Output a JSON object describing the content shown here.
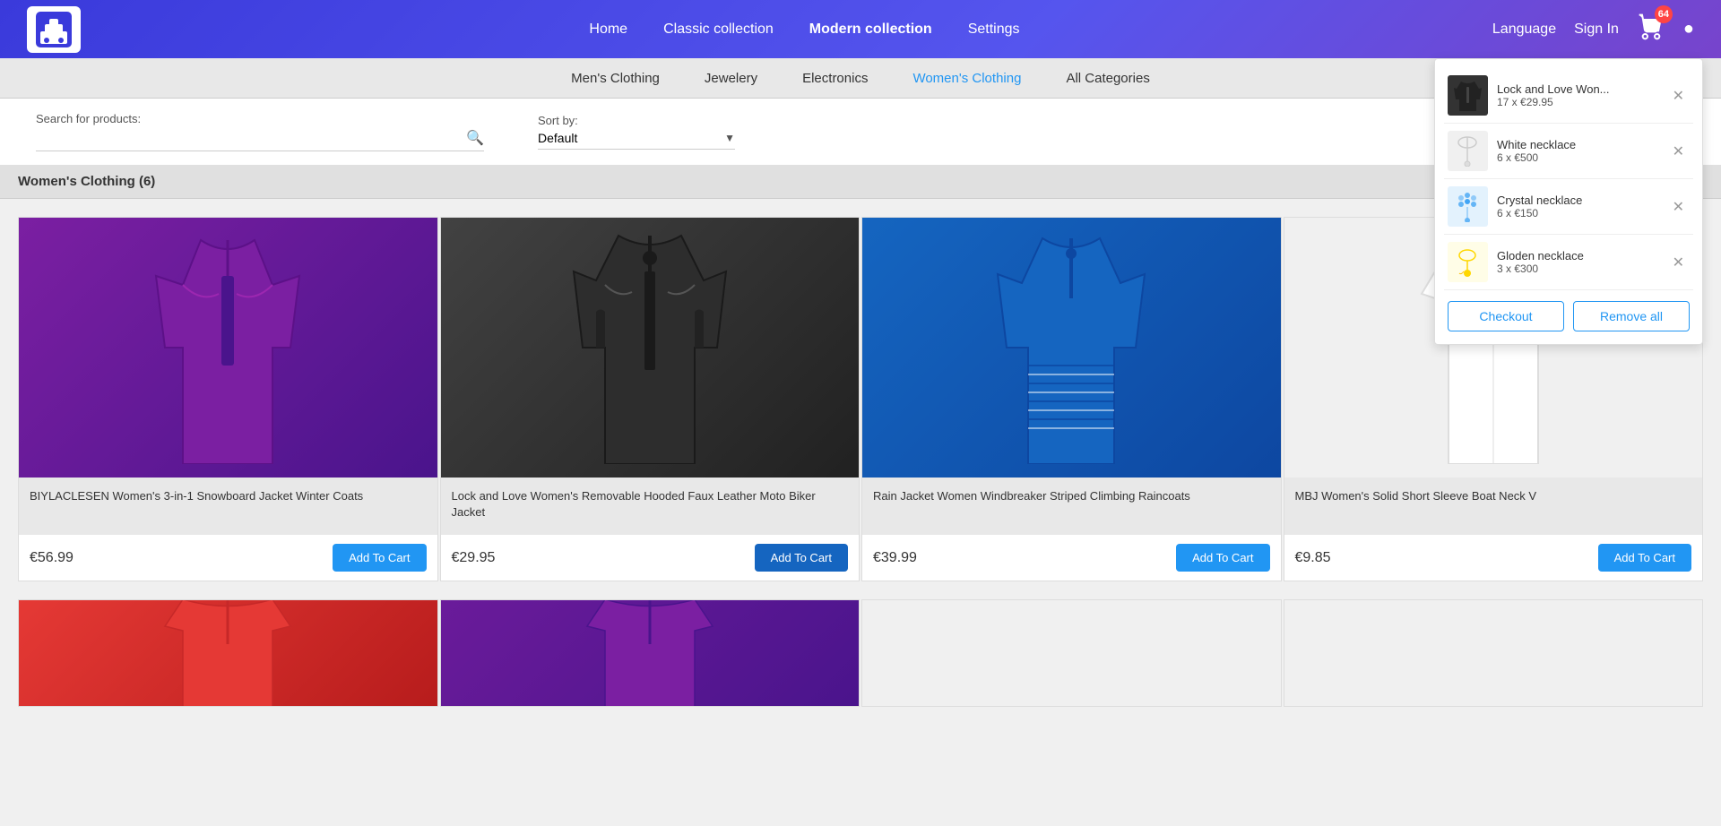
{
  "nav": {
    "links": [
      {
        "label": "Home",
        "active": false
      },
      {
        "label": "Classic collection",
        "active": false
      },
      {
        "label": "Modern collection",
        "active": true
      },
      {
        "label": "Settings",
        "active": false
      }
    ],
    "language": "Language",
    "sign_in": "Sign In",
    "cart_count": "64"
  },
  "categories": [
    {
      "label": "Men's Clothing",
      "active": false
    },
    {
      "label": "Jewelery",
      "active": false
    },
    {
      "label": "Electronics",
      "active": false
    },
    {
      "label": "Women's Clothing",
      "active": true
    },
    {
      "label": "All Categories",
      "active": false
    }
  ],
  "search": {
    "label": "Search for products:",
    "placeholder": ""
  },
  "sort": {
    "label": "Sort by:",
    "default": "Default"
  },
  "section_title": "Women's Clothing (6)",
  "products": [
    {
      "name": "BIYLACLESEN Women's 3-in-1 Snowboard Jacket Winter Coats",
      "price": "€56.99",
      "btn_label": "Add To Cart",
      "emoji": "🧥",
      "color": "#7B1FA2"
    },
    {
      "name": "Lock and Love Women's Removable Hooded Faux Leather Moto Biker Jacket",
      "price": "€29.95",
      "btn_label": "Add To Cart",
      "emoji": "🥼",
      "color": "#212121"
    },
    {
      "name": "Rain Jacket Women Windbreaker Striped Climbing Raincoats",
      "price": "€39.99",
      "btn_label": "Add To Cart",
      "emoji": "🧥",
      "color": "#1565C0"
    },
    {
      "name": "MBJ Women's Solid Short Sleeve Boat Neck V",
      "price": "€9.85",
      "btn_label": "Add To Cart",
      "emoji": "👕",
      "color": "#f5f5f5"
    }
  ],
  "partial_products": [
    {
      "emoji": "👚",
      "color": "#E53935"
    },
    {
      "emoji": "👕",
      "color": "#6A1B9A"
    }
  ],
  "cart": {
    "items": [
      {
        "name": "Lock and Love Won...",
        "details": "17 x €29.95",
        "emoji": "🥼",
        "color": "#212121"
      },
      {
        "name": "White necklace",
        "details": "6 x €500",
        "emoji": "📿",
        "color": "#f5f5f5"
      },
      {
        "name": "Crystal necklace",
        "details": "6 x €150",
        "emoji": "💎",
        "color": "#90CAF9"
      },
      {
        "name": "Gloden necklace",
        "details": "3 x €300",
        "emoji": "📿",
        "color": "#FFD700"
      }
    ],
    "checkout_label": "Checkout",
    "remove_all_label": "Remove all"
  }
}
